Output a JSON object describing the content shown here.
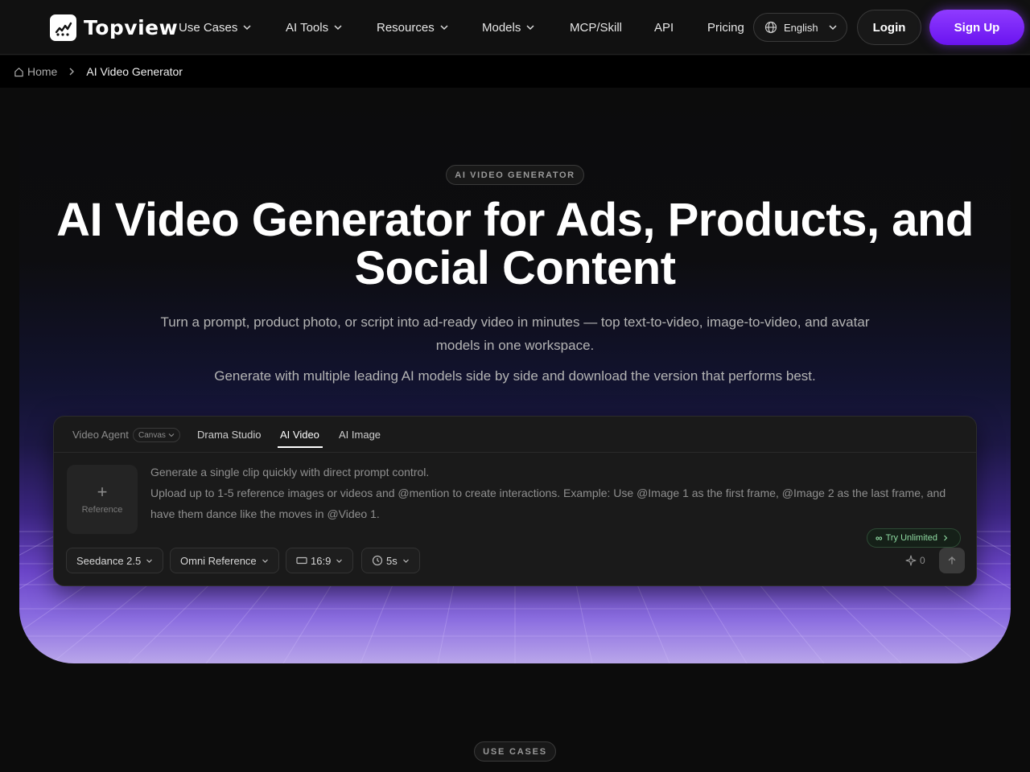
{
  "navbar": {
    "brand": "Topview",
    "items": [
      {
        "label": "Use Cases",
        "has_dropdown": true
      },
      {
        "label": "AI Tools",
        "has_dropdown": true
      },
      {
        "label": "Resources",
        "has_dropdown": true
      },
      {
        "label": "Models",
        "has_dropdown": true
      },
      {
        "label": "MCP/Skill",
        "has_dropdown": false
      },
      {
        "label": "API",
        "has_dropdown": false
      },
      {
        "label": "Pricing",
        "has_dropdown": false
      }
    ],
    "language": "English",
    "login_label": "Login",
    "signup_label": "Sign Up",
    "accent_color": "#7b22ff"
  },
  "breadcrumb": {
    "home": "Home",
    "current": "AI Video Generator"
  },
  "hero": {
    "tag": "AI VIDEO GENERATOR",
    "title": "AI Video Generator for Ads, Products, and Social Content",
    "subtitle": "Turn a prompt, product photo, or script into ad-ready video in minutes — top text-to-video, image-to-video, and avatar models in one workspace.",
    "subtitle2": "Generate with multiple leading AI models side by side and download the version that performs best."
  },
  "generator": {
    "tabs": [
      {
        "label": "Video Agent",
        "active": false
      },
      {
        "label": "Drama Studio",
        "active": false
      },
      {
        "label": "AI Video",
        "active": true
      },
      {
        "label": "AI Image",
        "active": false
      }
    ],
    "canvas_chip": "Canvas",
    "reference_label": "Reference",
    "prompt_line1": "Generate a single clip quickly with direct prompt control.",
    "prompt_line2": "Upload up to 1-5 reference images or videos and @mention to create interactions. Example: Use @Image 1 as the first frame, @Image 2 as the last frame, and have them dance like the moves in @Video 1.",
    "try_unlimited": "Try Unlimited",
    "model": "Seedance 2.5",
    "mode": "Omni Reference",
    "aspect_ratio": "16:9",
    "duration": "5s",
    "credits": "0"
  },
  "section": {
    "use_cases_tag": "USE CASES"
  }
}
